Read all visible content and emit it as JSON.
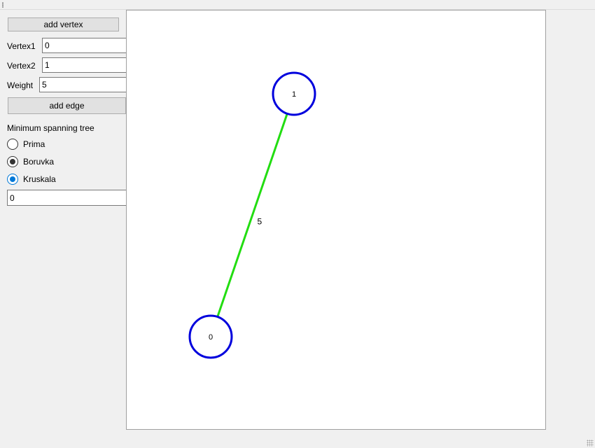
{
  "controls": {
    "add_vertex_label": "add vertex",
    "vertex1_label": "Vertex1",
    "vertex1_value": "0",
    "vertex2_label": "Vertex2",
    "vertex2_value": "1",
    "weight_label": "Weight",
    "weight_value": "5",
    "add_edge_label": "add edge",
    "mst_label": "Minimum spanning tree",
    "algorithms": [
      {
        "label": "Prima",
        "state": "unchecked"
      },
      {
        "label": "Boruvka",
        "state": "checked-dark"
      },
      {
        "label": "Kruskala",
        "state": "checked-blue"
      }
    ],
    "result_value": "0"
  },
  "graph": {
    "vertices": [
      {
        "label": "0"
      },
      {
        "label": "1"
      }
    ],
    "edges": [
      {
        "from": "0",
        "to": "1",
        "weight": "5"
      }
    ]
  },
  "colors": {
    "vertex_stroke": "#0000dd",
    "edge_stroke": "#22dd11",
    "accent_radio": "#0078d7"
  }
}
